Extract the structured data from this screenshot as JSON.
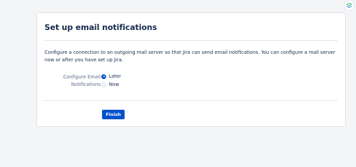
{
  "colors": {
    "accent": "#0052cc",
    "page_background": "#f4f5f7",
    "card_background": "#ffffff"
  },
  "top_icon": {
    "name": "extension-badge-icon"
  },
  "setup": {
    "title": "Set up email notifications",
    "description": "Configure a connection to an outgoing mail server so that Jira can send email notifications. You can configure a mail server now or after you have set up Jira.",
    "field_label": "Configure Email Notifications",
    "options": [
      {
        "label": "Later",
        "selected": true
      },
      {
        "label": "Now",
        "selected": false
      }
    ],
    "finish_label": "Finish"
  }
}
